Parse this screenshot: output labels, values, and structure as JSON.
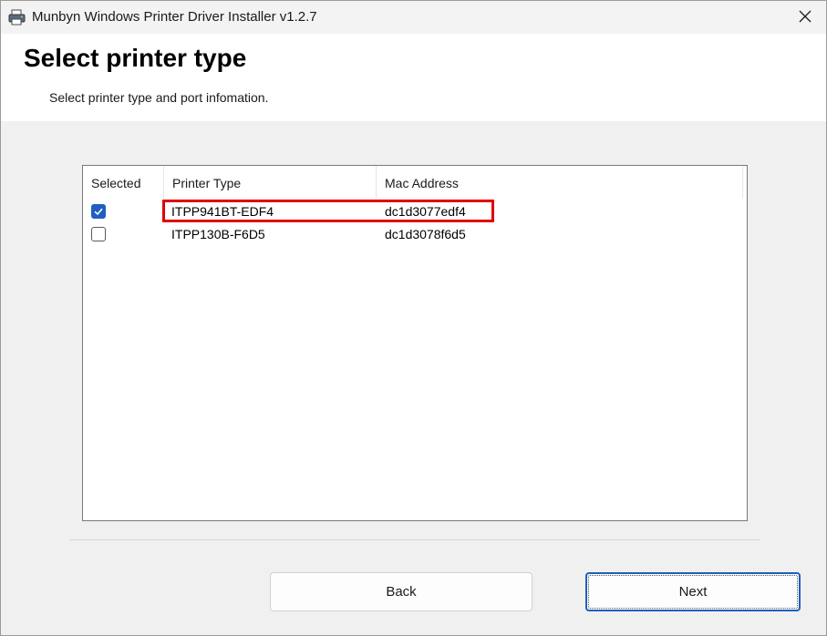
{
  "window": {
    "title": "Munbyn Windows Printer Driver Installer v1.2.7"
  },
  "header": {
    "title": "Select printer type",
    "subtitle": "Select printer type and port infomation."
  },
  "table": {
    "columns": [
      "Selected",
      "Printer Type",
      "Mac Address"
    ],
    "rows": [
      {
        "selected": true,
        "printer_type": "ITPP941BT-EDF4",
        "mac_address": "dc1d3077edf4"
      },
      {
        "selected": false,
        "printer_type": "ITPP130B-F6D5",
        "mac_address": "dc1d3078f6d5"
      }
    ]
  },
  "buttons": {
    "back": "Back",
    "next": "Next"
  },
  "colors": {
    "accent": "#1f5fbf",
    "highlight": "#e00000"
  },
  "icons": {
    "app": "printer-icon",
    "close": "close-icon",
    "check": "checkmark-icon"
  }
}
